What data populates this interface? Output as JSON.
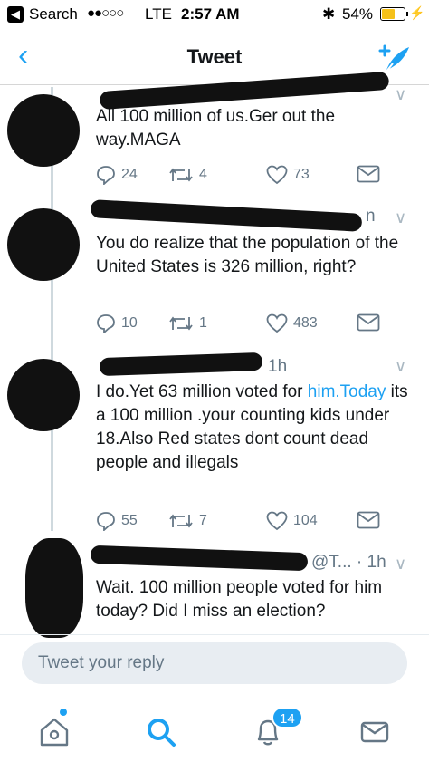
{
  "status_bar": {
    "back_app": "Search",
    "signal": "●●○○○",
    "carrier": "LTE",
    "time": "2:57 AM",
    "battery": "54%",
    "battery_fraction": 0.54
  },
  "nav": {
    "back_icon": "chevron-left-icon",
    "title": "Tweet",
    "compose_icon": "compose-tweet-icon"
  },
  "tweets": [
    {
      "meta": "",
      "text": "All 100 million of us.Ger out the way.MAGA",
      "replies": "24",
      "retweets": "4",
      "likes": "73"
    },
    {
      "meta": "n",
      "text": "You do realize that the population of the United States is 326 million, right?",
      "replies": "10",
      "retweets": "1",
      "likes": "483"
    },
    {
      "meta": "1h",
      "text_pre": "I do.Yet 63 million voted for ",
      "text_link": "him.Today",
      "text_post": " its a 100 million .your counting kids under 18.Also Red states dont count dead people and illegals",
      "replies": "55",
      "retweets": "7",
      "likes": "104"
    },
    {
      "meta": "@T... · 1h",
      "text": "Wait. 100 million people voted for him today? Did I miss an election?"
    }
  ],
  "reply": {
    "placeholder": "Tweet your reply"
  },
  "tabbar": {
    "notifications_badge": "14"
  },
  "colors": {
    "accent": "#1da1f2",
    "muted": "#657786"
  }
}
